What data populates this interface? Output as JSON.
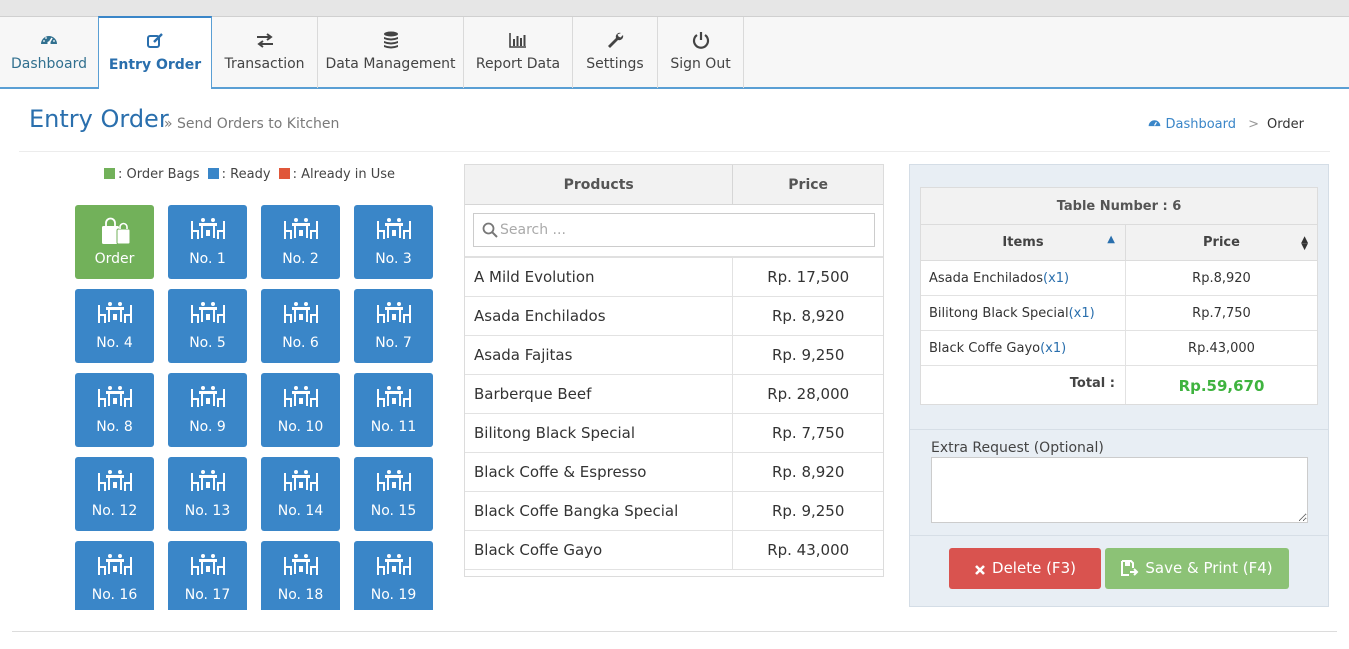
{
  "nav": {
    "tabs": [
      {
        "label": "Dashboard",
        "icon": "dashboard-icon"
      },
      {
        "label": "Entry Order",
        "icon": "edit-icon"
      },
      {
        "label": "Transaction",
        "icon": "exchange-icon"
      },
      {
        "label": "Data Management",
        "icon": "database-icon"
      },
      {
        "label": "Report Data",
        "icon": "bar-chart-icon"
      },
      {
        "label": "Settings",
        "icon": "wrench-icon"
      },
      {
        "label": "Sign Out",
        "icon": "power-icon"
      }
    ],
    "active": "Entry Order"
  },
  "page": {
    "title": "Entry Order",
    "subtitle": "» Send Orders to Kitchen",
    "breadcrumb": {
      "home": "Dashboard",
      "sep": ">",
      "current": "Order"
    }
  },
  "legend": {
    "items": [
      {
        "label": ": Order Bags",
        "color": "#72b15a"
      },
      {
        "label": ": Ready",
        "color": "#3a86c8"
      },
      {
        "label": ": Already in Use",
        "color": "#e0573a"
      }
    ]
  },
  "tables": {
    "order_tile": "Order",
    "tiles": [
      "No. 1",
      "No. 2",
      "No. 3",
      "No. 4",
      "No. 5",
      "No. 6",
      "No. 7",
      "No. 8",
      "No. 9",
      "No. 10",
      "No. 11",
      "No. 12",
      "No. 13",
      "No. 14",
      "No. 15",
      "No. 16",
      "No. 17",
      "No. 18",
      "No. 19"
    ]
  },
  "products": {
    "col_name": "Products",
    "col_price": "Price",
    "search_placeholder": "Search ...",
    "rows": [
      {
        "name": "A Mild Evolution",
        "price": "Rp. 17,500"
      },
      {
        "name": "Asada Enchilados",
        "price": "Rp. 8,920"
      },
      {
        "name": "Asada Fajitas",
        "price": "Rp. 9,250"
      },
      {
        "name": "Barberque Beef",
        "price": "Rp. 28,000"
      },
      {
        "name": "Bilitong Black Special",
        "price": "Rp. 7,750"
      },
      {
        "name": "Black Coffe & Espresso",
        "price": "Rp. 8,920"
      },
      {
        "name": "Black Coffe Bangka Special",
        "price": "Rp. 9,250"
      },
      {
        "name": "Black Coffe Gayo",
        "price": "Rp. 43,000"
      }
    ]
  },
  "order": {
    "table_label": "Table Number : 6",
    "col_items": "Items",
    "col_price": "Price",
    "rows": [
      {
        "item": "Asada Enchilados",
        "qty": "(x1)",
        "price": "Rp.8,920"
      },
      {
        "item": "Bilitong Black Special",
        "qty": "(x1)",
        "price": "Rp.7,750"
      },
      {
        "item": "Black Coffe Gayo",
        "qty": "(x1)",
        "price": "Rp.43,000"
      }
    ],
    "total_label": "Total :",
    "total_value": "Rp.59,670",
    "total_color": "#3fb33f",
    "extra_label": "Extra Request (Optional)",
    "extra_value": "",
    "delete_label": "Delete (F3)",
    "save_label": "Save & Print (F4)"
  },
  "colors": {
    "ready": "#3a86c8",
    "order_bags": "#72b15a",
    "in_use": "#e0573a",
    "delete": "#d9534f",
    "save": "#8cc276"
  }
}
